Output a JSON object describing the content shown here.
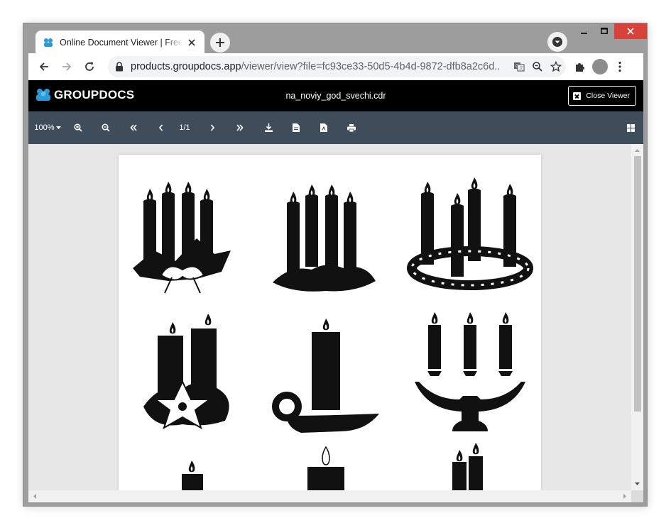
{
  "browser": {
    "tab_title": "Online Document Viewer | Free GroupDocs App",
    "url_host": "products.groupdocs.app",
    "url_path": "/viewer/view?file=fc93ce33-50d5-4b4d-9872-dfb8a2c6d..."
  },
  "app": {
    "brand": "GROUPDOCS",
    "filename": "na_noviy_god_svechi.cdr",
    "close_label": "Close Viewer"
  },
  "viewer_toolbar": {
    "zoom": "100%",
    "page_indicator": "1/1"
  },
  "icons": {
    "tab_favicon": "groupdocs-icon",
    "brand_logo": "groupdocs-logo-icon",
    "doc_content": "candles-illustration"
  },
  "colors": {
    "header_bg": "#000000",
    "toolbar_bg": "#3f4d5b",
    "brand_accent": "#2a9bd8",
    "close_button": "#d9413b"
  }
}
